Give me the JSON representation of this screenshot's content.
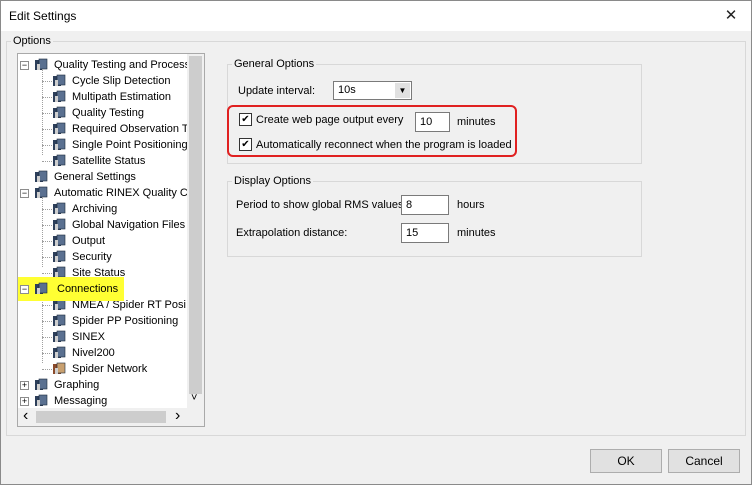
{
  "window": {
    "title": "Edit Settings",
    "close_glyph": "✕"
  },
  "options_group": {
    "legend": "Options"
  },
  "tree": {
    "items": [
      {
        "label": "Quality Testing and Process",
        "level": 0,
        "expander": "−"
      },
      {
        "label": "Cycle Slip Detection",
        "level": 1
      },
      {
        "label": "Multipath Estimation",
        "level": 1
      },
      {
        "label": "Quality Testing",
        "level": 1
      },
      {
        "label": "Required Observation T",
        "level": 1
      },
      {
        "label": "Single Point Positioning",
        "level": 1
      },
      {
        "label": "Satellite Status",
        "level": 1
      },
      {
        "label": "General Settings",
        "level": 0
      },
      {
        "label": "Automatic RINEX Quality Ch",
        "level": 0,
        "expander": "−"
      },
      {
        "label": "Archiving",
        "level": 1
      },
      {
        "label": "Global Navigation Files",
        "level": 1
      },
      {
        "label": "Output",
        "level": 1
      },
      {
        "label": "Security",
        "level": 1
      },
      {
        "label": "Site Status",
        "level": 1
      },
      {
        "label": "Connections",
        "level": 0,
        "expander": "−",
        "highlighted": true
      },
      {
        "label": "NMEA / Spider RT Posi",
        "level": 1
      },
      {
        "label": "Spider PP Positioning",
        "level": 1
      },
      {
        "label": "SINEX",
        "level": 1
      },
      {
        "label": "Nivel200",
        "level": 1
      },
      {
        "label": "Spider Network",
        "level": 1
      },
      {
        "label": "Graphing",
        "level": 0,
        "expander": "+"
      },
      {
        "label": "Messaging",
        "level": 0,
        "expander": "+"
      }
    ],
    "scroll_left_glyph": "‹",
    "scroll_right_glyph": "›",
    "scroll_down_glyph": "˅"
  },
  "general_options": {
    "legend": "General Options",
    "update_interval_label": "Update interval:",
    "update_interval_value": "10s",
    "web_output_label": "Create web page output every",
    "web_output_value": "10",
    "web_output_unit": "minutes",
    "web_output_checked": true,
    "reconnect_label": "Automatically reconnect when the program is loaded",
    "reconnect_checked": true,
    "checkmark": "✔"
  },
  "display_options": {
    "legend": "Display Options",
    "rms_label": "Period to show global RMS values:",
    "rms_value": "8",
    "rms_unit": "hours",
    "extrap_label": "Extrapolation distance:",
    "extrap_value": "15",
    "extrap_unit": "minutes"
  },
  "buttons": {
    "ok": "OK",
    "cancel": "Cancel"
  },
  "colors": {
    "highlight": "#ffff33",
    "red_annotation": "#e02020"
  }
}
